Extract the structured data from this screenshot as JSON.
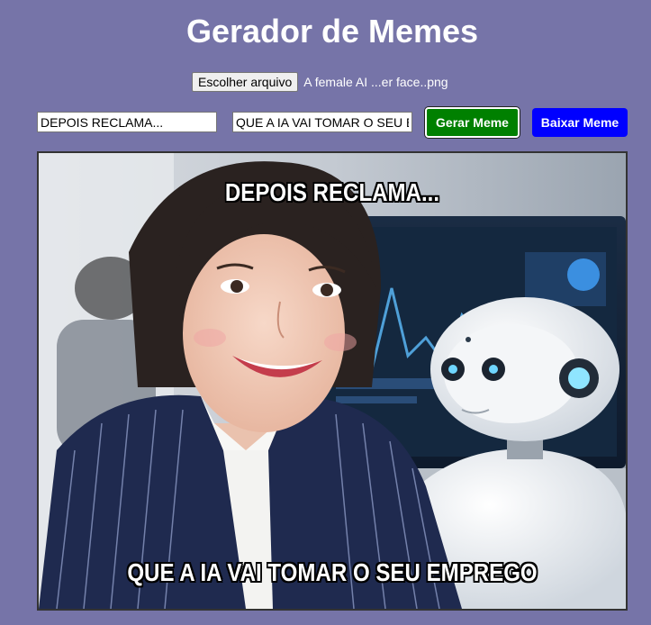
{
  "app": {
    "title": "Gerador de Memes"
  },
  "file_picker": {
    "button_label": "Escolher arquivo",
    "selected_file": "A female AI ...er face..png"
  },
  "inputs": {
    "top_text_value": "DEPOIS RECLAMA...",
    "bottom_text_value": "QUE A IA VAI TOMAR O SEU EMPREGO"
  },
  "buttons": {
    "generate_label": "Gerar Meme",
    "download_label": "Baixar Meme"
  },
  "meme": {
    "top_caption": "DEPOIS RECLAMA...",
    "bottom_caption": "QUE A IA VAI TOMAR O SEU EMPREGO"
  },
  "colors": {
    "background": "#7674a8",
    "generate_button": "#008000",
    "download_button": "#0000ff"
  }
}
